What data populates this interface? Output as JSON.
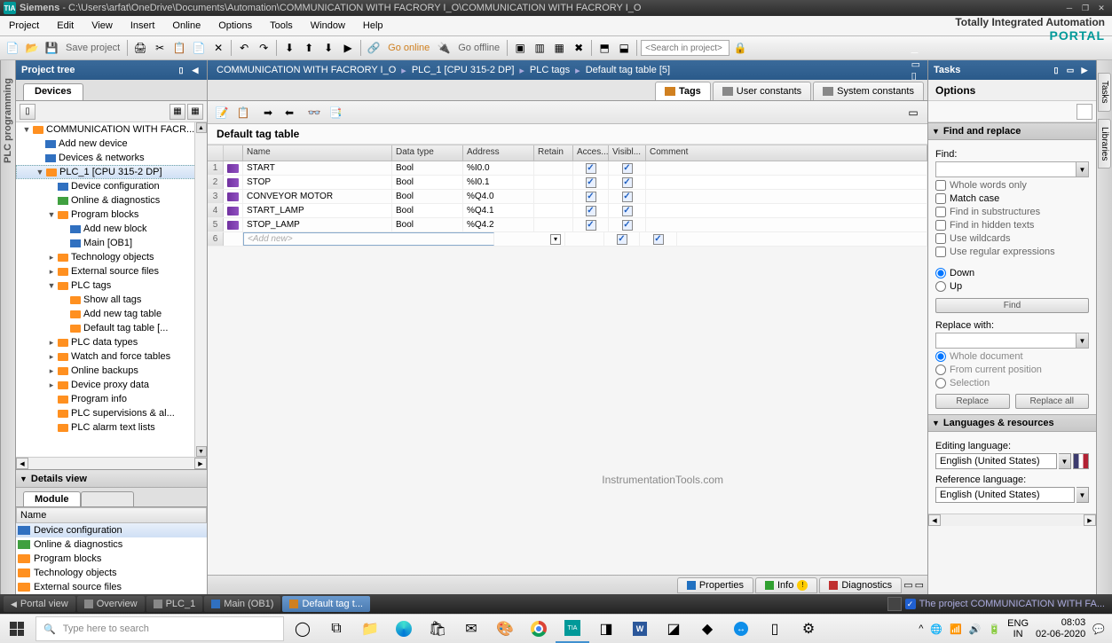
{
  "titlebar": {
    "app": "Siemens",
    "path": "- C:\\Users\\arfat\\OneDrive\\Documents\\Automation\\COMMUNICATION WITH FACRORY I_O\\COMMUNICATION WITH FACRORY I_O"
  },
  "menu": [
    "Project",
    "Edit",
    "View",
    "Insert",
    "Online",
    "Options",
    "Tools",
    "Window",
    "Help"
  ],
  "brand": {
    "line1": "Totally Integrated Automation",
    "line2": "PORTAL"
  },
  "toolbar": {
    "save": "Save project",
    "online": "Go online",
    "offline": "Go offline",
    "search_ph": "<Search in project>"
  },
  "tree_panel": {
    "title": "Project tree",
    "tab": "Devices"
  },
  "tree": [
    {
      "l": 0,
      "exp": "▼",
      "ic": "orange",
      "t": "COMMUNICATION WITH FACR..."
    },
    {
      "l": 1,
      "exp": "",
      "ic": "blue",
      "t": "Add new device"
    },
    {
      "l": 1,
      "exp": "",
      "ic": "blue",
      "t": "Devices & networks"
    },
    {
      "l": 1,
      "exp": "▼",
      "ic": "orange",
      "t": "PLC_1 [CPU 315-2 DP]",
      "sel": true
    },
    {
      "l": 2,
      "exp": "",
      "ic": "blue",
      "t": "Device configuration"
    },
    {
      "l": 2,
      "exp": "",
      "ic": "green",
      "t": "Online & diagnostics"
    },
    {
      "l": 2,
      "exp": "▼",
      "ic": "orange",
      "t": "Program blocks"
    },
    {
      "l": 3,
      "exp": "",
      "ic": "blue",
      "t": "Add new block"
    },
    {
      "l": 3,
      "exp": "",
      "ic": "blue",
      "t": "Main [OB1]"
    },
    {
      "l": 2,
      "exp": "▸",
      "ic": "orange",
      "t": "Technology objects"
    },
    {
      "l": 2,
      "exp": "▸",
      "ic": "orange",
      "t": "External source files"
    },
    {
      "l": 2,
      "exp": "▼",
      "ic": "orange",
      "t": "PLC tags"
    },
    {
      "l": 3,
      "exp": "",
      "ic": "orange",
      "t": "Show all tags"
    },
    {
      "l": 3,
      "exp": "",
      "ic": "orange",
      "t": "Add new tag table"
    },
    {
      "l": 3,
      "exp": "",
      "ic": "orange",
      "t": "Default tag table [..."
    },
    {
      "l": 2,
      "exp": "▸",
      "ic": "orange",
      "t": "PLC data types"
    },
    {
      "l": 2,
      "exp": "▸",
      "ic": "orange",
      "t": "Watch and force tables"
    },
    {
      "l": 2,
      "exp": "▸",
      "ic": "orange",
      "t": "Online backups"
    },
    {
      "l": 2,
      "exp": "▸",
      "ic": "orange",
      "t": "Device proxy data"
    },
    {
      "l": 2,
      "exp": "",
      "ic": "orange",
      "t": "Program info"
    },
    {
      "l": 2,
      "exp": "",
      "ic": "orange",
      "t": "PLC supervisions & al..."
    },
    {
      "l": 2,
      "exp": "",
      "ic": "orange",
      "t": "PLC alarm text lists"
    }
  ],
  "left_vtab": "PLC programming",
  "details": {
    "title": "Details view",
    "tab": "Module",
    "col": "Name",
    "rows": [
      {
        "ic": "blue",
        "t": "Device configuration",
        "sel": true
      },
      {
        "ic": "green",
        "t": "Online & diagnostics"
      },
      {
        "ic": "orange",
        "t": "Program blocks"
      },
      {
        "ic": "orange",
        "t": "Technology objects"
      },
      {
        "ic": "orange",
        "t": "External source files"
      }
    ]
  },
  "breadcrumb": [
    "COMMUNICATION WITH FACRORY I_O",
    "PLC_1 [CPU 315-2 DP]",
    "PLC tags",
    "Default tag table [5]"
  ],
  "ed_tabs": {
    "tags": "Tags",
    "user": "User constants",
    "sys": "System constants"
  },
  "table_title": "Default tag table",
  "cols": {
    "name": "Name",
    "dt": "Data type",
    "addr": "Address",
    "ret": "Retain",
    "acc": "Acces...",
    "vis": "Visibl...",
    "com": "Comment"
  },
  "tags": [
    {
      "n": "1",
      "name": "START",
      "dt": "Bool",
      "addr": "%I0.0",
      "acc": true,
      "vis": true
    },
    {
      "n": "2",
      "name": "STOP",
      "dt": "Bool",
      "addr": "%I0.1",
      "acc": true,
      "vis": true
    },
    {
      "n": "3",
      "name": "CONVEYOR MOTOR",
      "dt": "Bool",
      "addr": "%Q4.0",
      "acc": true,
      "vis": true
    },
    {
      "n": "4",
      "name": "START_LAMP",
      "dt": "Bool",
      "addr": "%Q4.1",
      "acc": true,
      "vis": true
    },
    {
      "n": "5",
      "name": "STOP_LAMP",
      "dt": "Bool",
      "addr": "%Q4.2",
      "acc": true,
      "vis": true
    }
  ],
  "addnew": "<Add new>",
  "ed_bottom": {
    "prop": "Properties",
    "info": "Info",
    "diag": "Diagnostics"
  },
  "watermark": "InstrumentationTools.com",
  "tasks": {
    "title": "Tasks",
    "options": "Options",
    "find": {
      "hdr": "Find and replace",
      "find": "Find:",
      "whole": "Whole words only",
      "match": "Match case",
      "substr": "Find in substructures",
      "hidden": "Find in hidden texts",
      "wild": "Use wildcards",
      "regex": "Use regular expressions",
      "down": "Down",
      "up": "Up",
      "findbtn": "Find",
      "replwith": "Replace with:",
      "wholedoc": "Whole document",
      "fromcur": "From current position",
      "sel": "Selection",
      "repl": "Replace",
      "replall": "Replace all"
    },
    "lang": {
      "hdr": "Languages & resources",
      "edit": "Editing language:",
      "ref": "Reference language:",
      "val": "English (United States)"
    }
  },
  "right_vtabs": [
    "Tasks",
    "Libraries"
  ],
  "statusbar": {
    "portal": "Portal view",
    "tabs": [
      "Overview",
      "PLC_1",
      "Main (OB1)",
      "Default tag t..."
    ],
    "msg": "The project COMMUNICATION WITH FA..."
  },
  "taskbar": {
    "search_ph": "Type here to search",
    "lang": "ENG",
    "region": "IN",
    "time": "08:03",
    "date": "02-06-2020"
  }
}
